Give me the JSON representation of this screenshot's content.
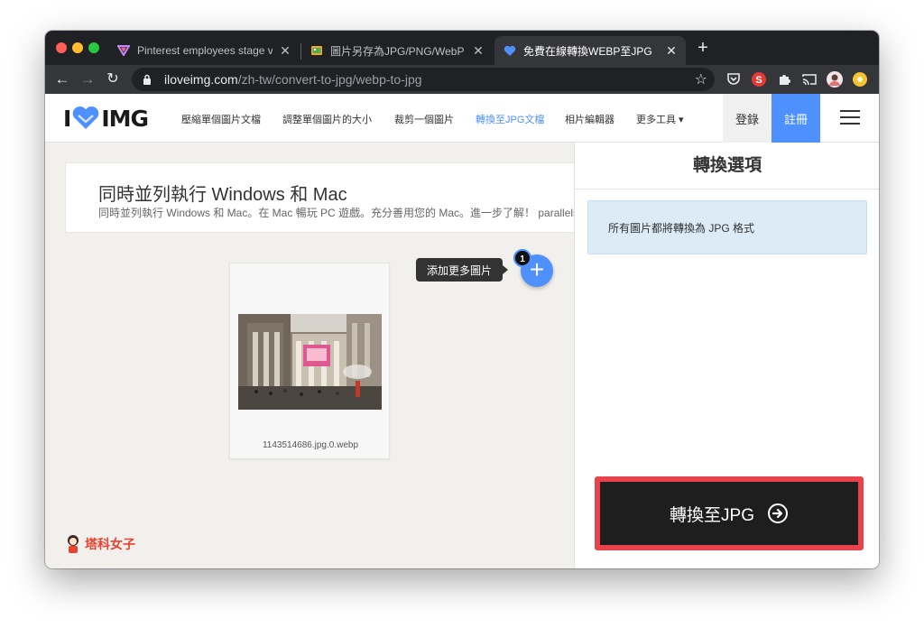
{
  "browser": {
    "tabs": [
      {
        "title": "Pinterest employees stage virtu",
        "favicon": "pinterest-triangle-icon"
      },
      {
        "title": "圖片另存為JPG/PNG/WebP - Ch",
        "favicon": "image-save-icon"
      },
      {
        "title": "免費在線轉換WEBP至JPG",
        "favicon": "iloveimg-heart-icon",
        "active": true
      }
    ],
    "new_tab_label": "+",
    "url_host": "iloveimg.com",
    "url_path": "/zh-tw/convert-to-jpg/webp-to-jpg"
  },
  "site": {
    "logo_left": "I",
    "logo_right": "IMG",
    "nav": [
      {
        "label": "壓縮單個圖片文檔"
      },
      {
        "label": "調整單個圖片的大小"
      },
      {
        "label": "裁剪一個圖片"
      },
      {
        "label": "轉換至JPG文檔",
        "active": true
      },
      {
        "label": "相片編輯器"
      },
      {
        "label": "更多工具 ▾"
      }
    ],
    "login_label": "登錄",
    "register_label": "註冊"
  },
  "ad": {
    "title": "同時並列執行 Windows 和 Mac",
    "description": "同時並列執行 Windows 和 Mac。在 Mac 暢玩 PC 遊戲。充分善用您的 Mac。進一步了解！ parallels.com"
  },
  "workspace": {
    "add_more_tooltip": "添加更多圖片",
    "add_button": "+",
    "file_count": "1",
    "file_name": "1143514686.jpg.0.webp",
    "watermark": "塔科女子"
  },
  "sidebar": {
    "title": "轉換選項",
    "info": "所有圖片都將轉換為 JPG 格式",
    "convert_label": "轉換至JPG"
  },
  "colors": {
    "accent": "#4d90fe",
    "highlight_border": "#e8434a",
    "convert_button": "#1e1e1e",
    "info_bg": "#ddebf7"
  }
}
